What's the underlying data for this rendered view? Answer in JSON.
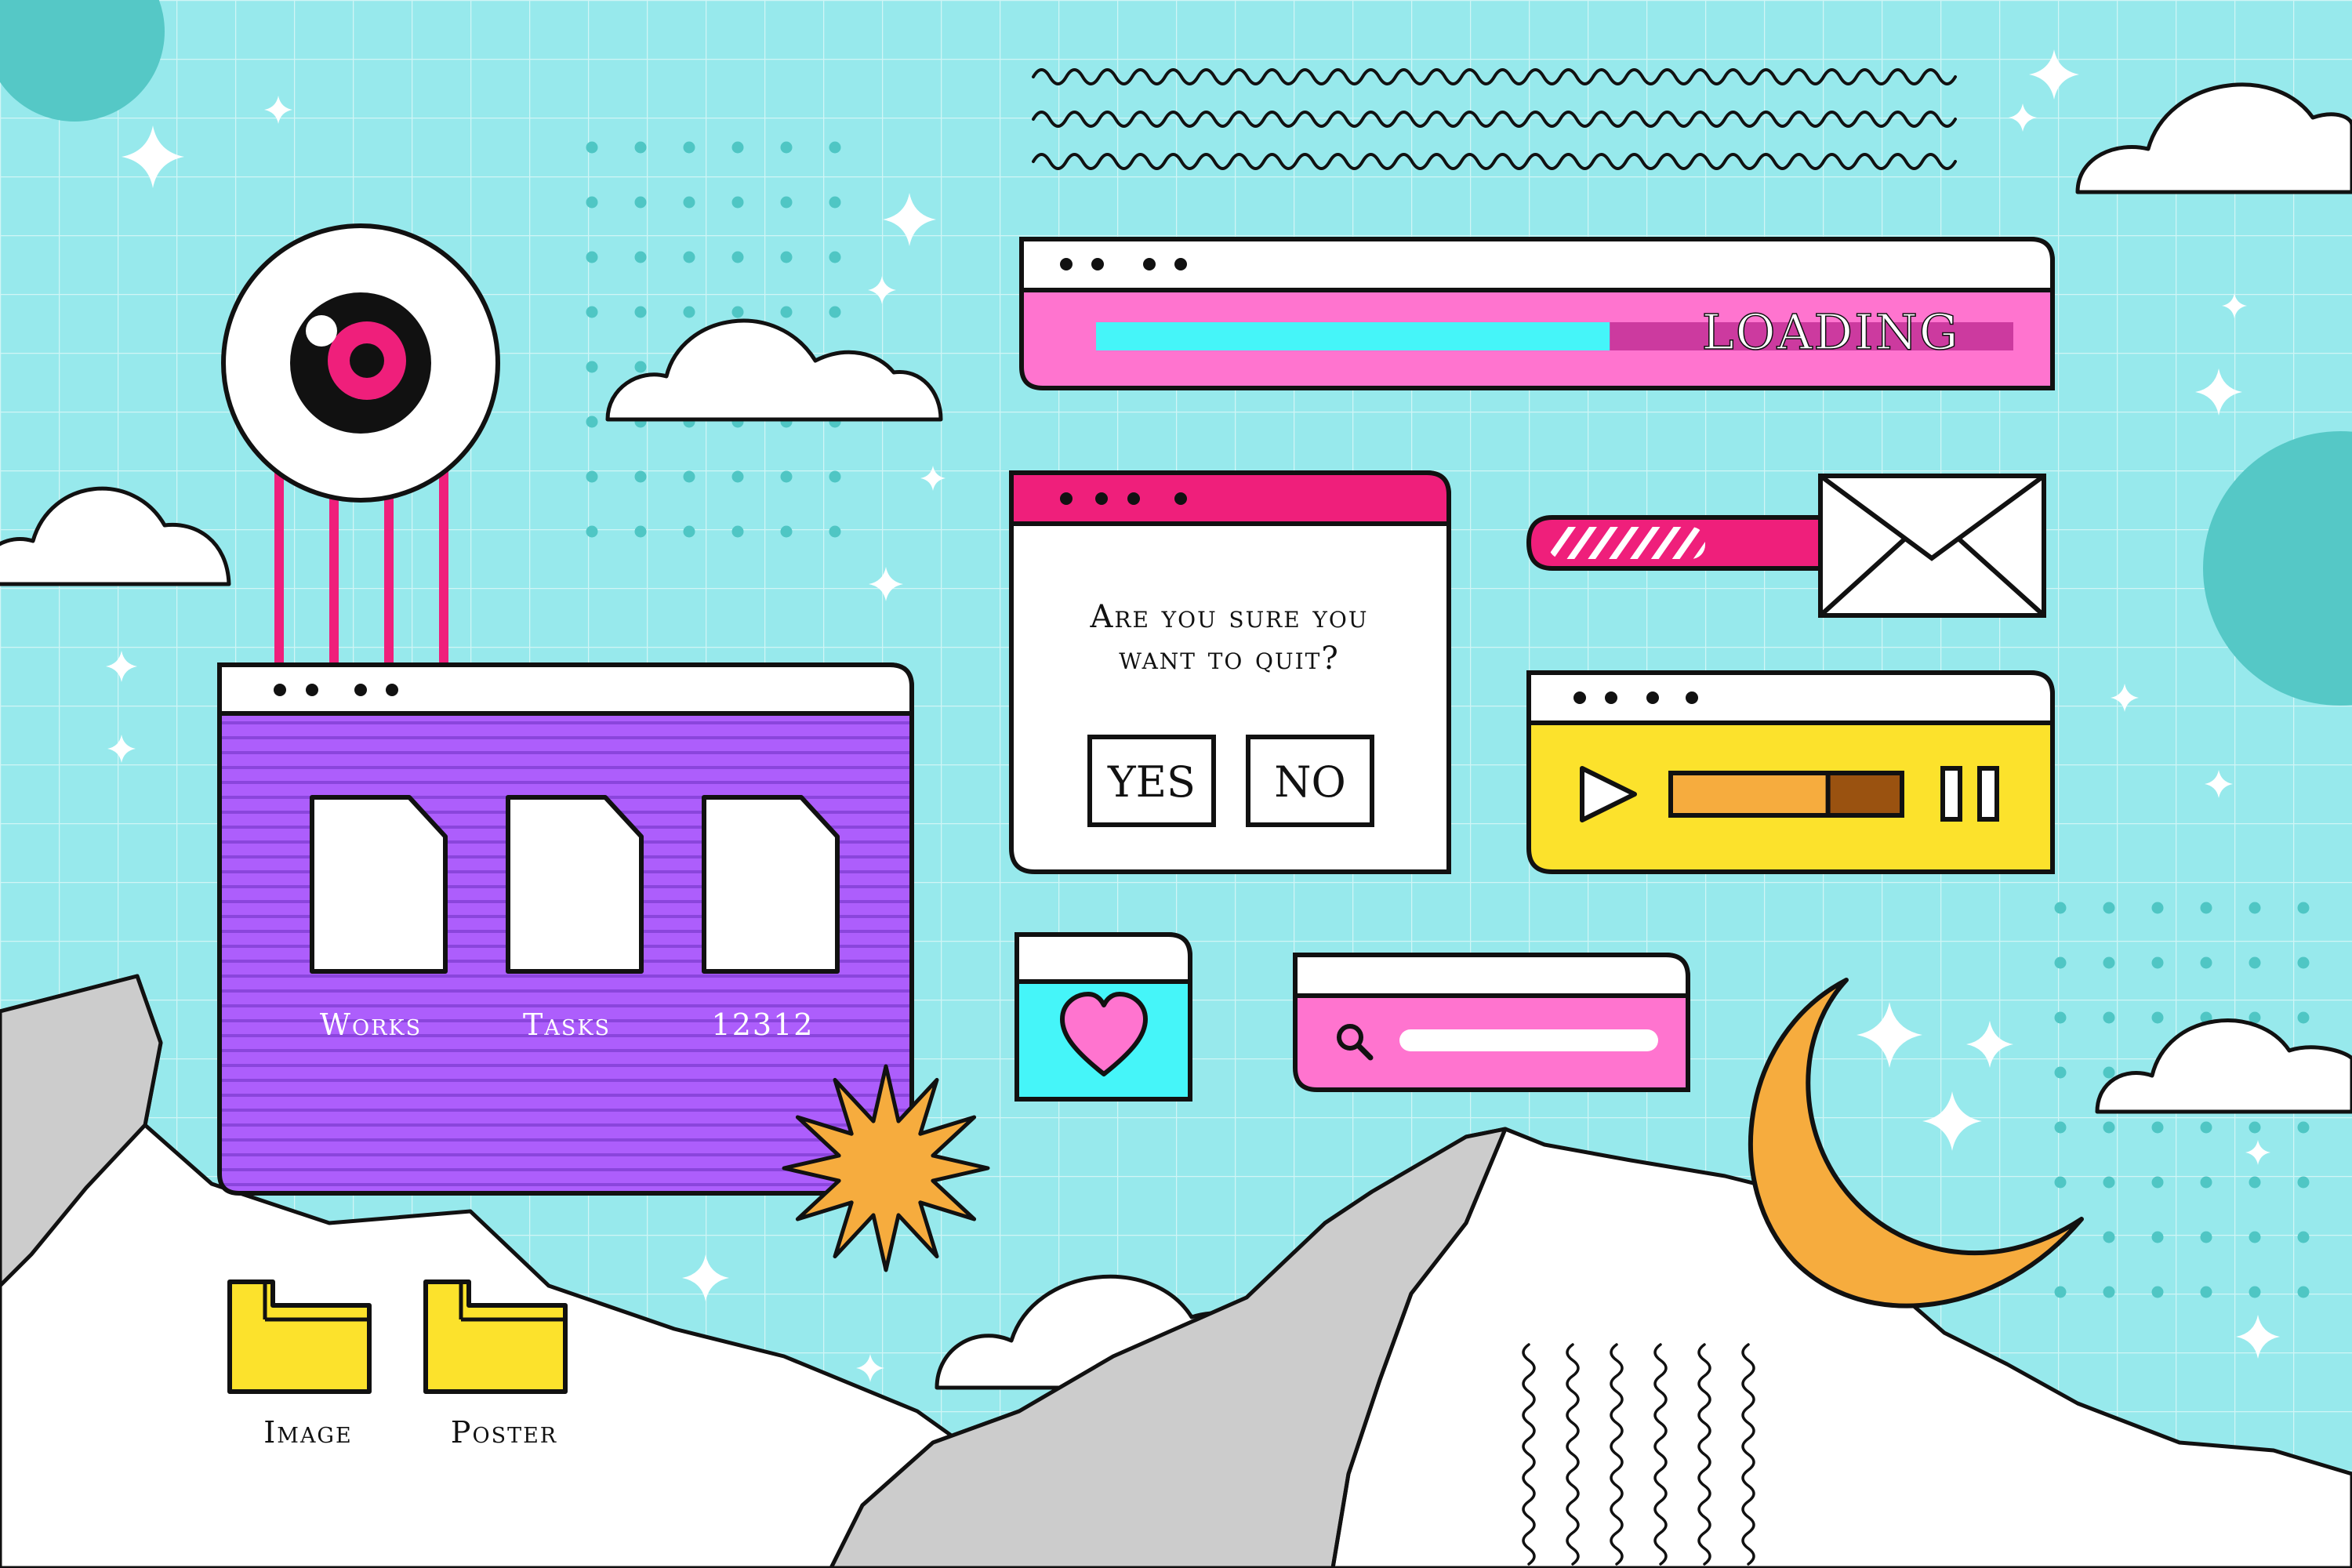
{
  "colors": {
    "sky": "#97e9ec",
    "grid": "#ffffff",
    "outline": "#111111",
    "dot": "#4fc6c4",
    "bubble": "#55c8c6",
    "pink": "#ff74cf",
    "hot_pink": "#ef1f7b",
    "cyan": "#45f5f9",
    "purple": "#ad5efc",
    "purple_line": "#7d3bd0",
    "yellow": "#fce22c",
    "orange": "#f6ac3e",
    "brown": "#9a5210",
    "mountain_gray": "#cccccc",
    "white": "#ffffff"
  },
  "loading_window": {
    "label": "LOADING",
    "progress": 0.56,
    "icons": [
      "window-dots-icon"
    ]
  },
  "quit_dialog": {
    "line1": "Are you sure you",
    "line2": "want to quit?",
    "yes_label": "YES",
    "no_label": "NO"
  },
  "mail_widget": {
    "icons": [
      "envelope-icon"
    ]
  },
  "media_player": {
    "progress": 0.68,
    "icons": [
      "play-icon",
      "pause-icon"
    ]
  },
  "search_widget": {
    "placeholder": "",
    "icons": [
      "search-icon"
    ]
  },
  "favorite_widget": {
    "icons": [
      "heart-icon"
    ]
  },
  "file_window": {
    "files": [
      {
        "label": "Works"
      },
      {
        "label": "Tasks"
      },
      {
        "label": "12312"
      }
    ]
  },
  "desktop": {
    "folders": [
      {
        "label": "Image"
      },
      {
        "label": "Poster"
      }
    ]
  },
  "decor": {
    "icons": [
      "eyeball-icon",
      "cloud-icon",
      "sparkle-icon",
      "moon-icon",
      "burst-star-icon",
      "mountain-icon",
      "wave-lines-icon"
    ]
  }
}
